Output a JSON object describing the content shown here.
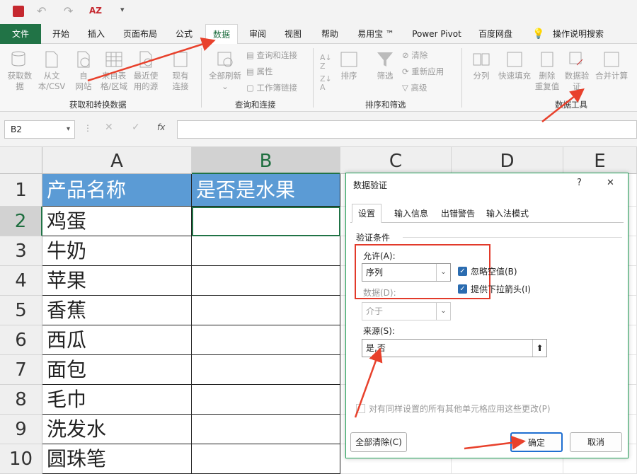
{
  "quick_access": {
    "save_icon": "save-icon",
    "sort_label": "AZ"
  },
  "tabs": [
    {
      "label": "文件"
    },
    {
      "label": "开始"
    },
    {
      "label": "插入"
    },
    {
      "label": "页面布局"
    },
    {
      "label": "公式"
    },
    {
      "label": "数据"
    },
    {
      "label": "审阅"
    },
    {
      "label": "视图"
    },
    {
      "label": "帮助"
    },
    {
      "label": "易用宝 ™"
    },
    {
      "label": "Power Pivot"
    },
    {
      "label": "百度网盘"
    },
    {
      "label": "操作说明搜索"
    }
  ],
  "ribbon": {
    "get_data": {
      "l1": "获取数",
      "l2": "据"
    },
    "from_text": {
      "l1": "从文",
      "l2": "本/CSV"
    },
    "from_web": {
      "l1": "自",
      "l2": "网站"
    },
    "from_table": {
      "l1": "来自表",
      "l2": "格/区域"
    },
    "recent_sources": {
      "l1": "最近使",
      "l2": "用的源"
    },
    "existing": {
      "l1": "现有",
      "l2": "连接"
    },
    "group1": "获取和转换数据",
    "refresh_all": {
      "l1": "全部刷新"
    },
    "queries_conn": "查询和连接",
    "properties": "属性",
    "workbook_links": "工作簿链接",
    "group2": "查询和连接",
    "sort": "排序",
    "filter": "筛选",
    "clear": "清除",
    "reapply": "重新应用",
    "advanced": "高级",
    "group3": "排序和筛选",
    "text_to_cols": "分列",
    "flash_fill": "快速填充",
    "remove_dup": {
      "l1": "删除",
      "l2": "重复值"
    },
    "data_validation": {
      "l1": "数据验",
      "l2": "证"
    },
    "consolidate": "合并计算",
    "group4": "数据工具"
  },
  "formula_bar": {
    "name_box": "B2",
    "fx": "fx"
  },
  "sheet": {
    "columns": [
      "A",
      "B",
      "C",
      "D",
      "E"
    ],
    "rows": [
      "1",
      "2",
      "3",
      "4",
      "5",
      "6",
      "7",
      "8",
      "9",
      "10"
    ],
    "header_a": "产品名称",
    "header_b": "是否是水果",
    "items": [
      "鸡蛋",
      "牛奶",
      "苹果",
      "香蕉",
      "西瓜",
      "面包",
      "毛巾",
      "洗发水",
      "圆珠笔"
    ]
  },
  "dialog": {
    "title": "数据验证",
    "help": "?",
    "close": "✕",
    "tabs": [
      "设置",
      "输入信息",
      "出错警告",
      "输入法模式"
    ],
    "section": "验证条件",
    "allow_label": "允许(A):",
    "allow_value": "序列",
    "ignore_blank": "忽略空值(B)",
    "dropdown": "提供下拉箭头(I)",
    "data_label": "数据(D):",
    "data_value": "介于",
    "source_label": "来源(S):",
    "source_value": "是,否",
    "apply_all": "对有同样设置的所有其他单元格应用这些更改(P)",
    "clear_all": "全部清除(C)",
    "ok": "确定",
    "cancel": "取消"
  },
  "colors": {
    "accent": "#217346",
    "header_fill": "#5b9bd5",
    "annotation": "#e8412c"
  }
}
